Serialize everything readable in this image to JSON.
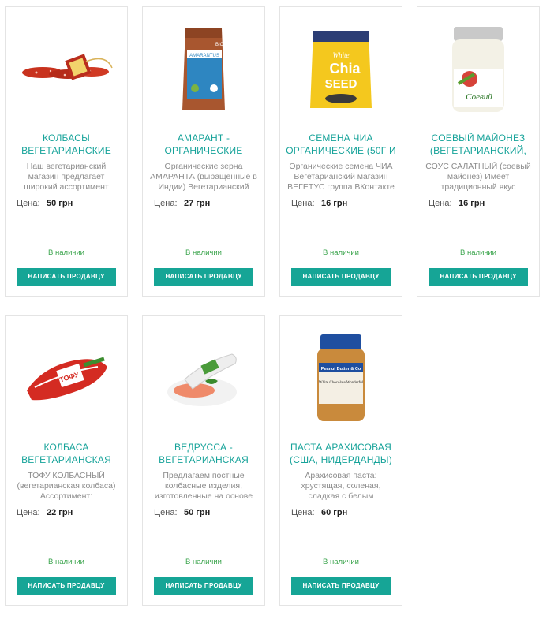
{
  "products": [
    {
      "title": "КОЛБАСЫ ВЕГЕТАРИАНСКИЕ",
      "desc": "Наш вегетарианский магазин предлагает широкий ассортимент",
      "price_label": "Цена:",
      "price": "50 грн",
      "stock": "В наличии",
      "button": "НАПИСАТЬ ПРОДАВЦУ",
      "image": "sausage-bundle"
    },
    {
      "title": "АМАРАНТ - ОРГАНИЧЕСКИЕ ЗЕРНА",
      "desc": "Органические зерна АМАРАНТА (выращенные в Индии) Вегетарианский",
      "price_label": "Цена:",
      "price": "27 грн",
      "stock": "В наличии",
      "button": "НАПИСАТЬ ПРОДАВЦУ",
      "image": "amaranth-bag"
    },
    {
      "title": "СЕМЕНА ЧИА ОРГАНИЧЕСКИЕ (50Г И",
      "desc": "Органические семена ЧИА Вегетарианский магазин ВЕГЕТУС группа ВКонтакте",
      "price_label": "Цена:",
      "price": "16 грн",
      "stock": "В наличии",
      "button": "НАПИСАТЬ ПРОДАВЦУ",
      "image": "chia-pouch"
    },
    {
      "title": "СОЕВЫЙ МАЙОНЕЗ (ВЕГЕТАРИАНСКИЙ,",
      "desc": "СОУС САЛАТНЫЙ (соевый майонез) Имеет традиционный вкус",
      "price_label": "Цена:",
      "price": "16 грн",
      "stock": "В наличии",
      "button": "НАПИСАТЬ ПРОДАВЦУ",
      "image": "mayonnaise-jar"
    },
    {
      "title": "КОЛБАСА ВЕГЕТАРИАНСКАЯ",
      "desc": "ТОФУ КОЛБАСНЫЙ (вегетарианская колбаса) Ассортимент:",
      "price_label": "Цена:",
      "price": "22 грн",
      "stock": "В наличии",
      "button": "НАПИСАТЬ ПРОДАВЦУ",
      "image": "tofu-sausage"
    },
    {
      "title": "ВЕДРУССА - ВЕГЕТАРИАНСКАЯ",
      "desc": "Предлагаем постные колбасные изделия, изготовленные на основе",
      "price_label": "Цена:",
      "price": "50 грн",
      "stock": "В наличии",
      "button": "НАПИСАТЬ ПРОДАВЦУ",
      "image": "vedrussa-sausage"
    },
    {
      "title": "ПАСТА АРАХИСОВАЯ (США, НИДЕРДАНДЫ)",
      "desc": "Арахисовая паста: хрустящая, соленая, сладкая с белым",
      "price_label": "Цена:",
      "price": "60 грн",
      "stock": "В наличии",
      "button": "НАПИСАТЬ ПРОДАВЦУ",
      "image": "peanut-butter-jar"
    }
  ],
  "image_text": {
    "amaranth_top": "BIO",
    "amaranth_label": "AMARANTUS",
    "chia_line1": "White",
    "chia_line2": "Chia",
    "chia_line3": "SEED",
    "mayo_text": "Соевий",
    "tofu_text": "ТОФУ",
    "pb_line1": "Peanut Butter & Co",
    "pb_line2": "White Chocolate Wonderful"
  },
  "colors": {
    "accent": "#16a596",
    "title": "#17a39a",
    "stock": "#3aa44c"
  }
}
